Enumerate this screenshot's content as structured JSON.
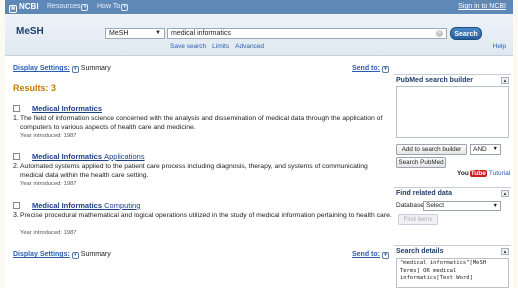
{
  "topbar": {
    "logo": "NCBI",
    "resources": "Resources",
    "howto": "How To",
    "signin": "Sign in to NCBI"
  },
  "search": {
    "db_label": "MeSH",
    "db_selected": "MeSH",
    "term": "medical informatics",
    "button": "Search",
    "links": [
      "Save search",
      "Limits",
      "Advanced"
    ],
    "help": "Help"
  },
  "main": {
    "display_settings": "Display Settings:",
    "format": "Summary",
    "send_to": "Send to:",
    "results_heading": "Results: 3",
    "results": [
      {
        "num": "1.",
        "title": "Medical Informatics",
        "subheading": "",
        "desc": "The field of information science concerned with the analysis and dissemination of medical data through the application of computers to various aspects of health care and medicine.",
        "year": "Year introduced: 1987"
      },
      {
        "num": "2.",
        "title": "Medical Informatics",
        "subheading": "Applications",
        "desc": "Automated systems applied to the patient care process including diagnosis, therapy, and systems of communicating medical data within the health care setting.",
        "year": "Year introduced: 1987"
      },
      {
        "num": "3.",
        "title": "Medical Informatics",
        "subheading": "Computing",
        "desc": "Precise procedural mathematical and logical operations utilized in the study of medical information pertaining to health care.",
        "year": "Year introduced: 1987"
      }
    ]
  },
  "sidebar": {
    "builder": {
      "title": "PubMed search builder",
      "add_button": "Add to search builder",
      "operator": "AND",
      "search_pubmed": "Search PubMed",
      "you": "You",
      "tube": "Tube",
      "tutorial": "Tutorial"
    },
    "related": {
      "title": "Find related data",
      "db_label": "Database:",
      "db_value": "Select",
      "find_button": "Find items"
    },
    "details": {
      "title": "Search details",
      "query": "\"medical informatics\"[MeSH Terms] OR medical informatics[Text Word]"
    }
  },
  "colors": {
    "topbar": "#5e89b6",
    "link": "#2a5db0",
    "results_heading": "#c47a00",
    "title_link": "#1e3e8a"
  }
}
